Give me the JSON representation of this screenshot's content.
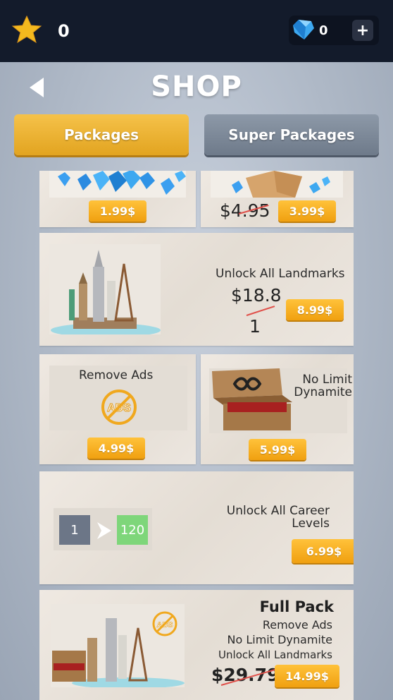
{
  "topbar": {
    "star_count": "0",
    "gem_count": "0",
    "plus_label": "+"
  },
  "header": {
    "title": "SHOP"
  },
  "tabs": [
    {
      "label": "Packages",
      "active": true
    },
    {
      "label": "Super Packages",
      "active": false
    }
  ],
  "packages": {
    "gems": {
      "price": "1.99$"
    },
    "crate": {
      "old_price": "$4.95",
      "price": "3.99$"
    },
    "landmarks": {
      "title": "Unlock All Landmarks",
      "old_price_line1": "$18.8",
      "old_price_line2": "1",
      "price": "8.99$"
    },
    "remove_ads": {
      "title": "Remove Ads",
      "badge": "ADS",
      "price": "4.99$"
    },
    "dynamite": {
      "title_line1": "No Limit",
      "title_line2": "Dynamite",
      "price": "5.99$"
    },
    "career": {
      "title_line1": "Unlock All Career",
      "title_line2": "Levels",
      "from_level": "1",
      "to_level": "120",
      "price": "6.99$"
    },
    "full_pack": {
      "title": "Full Pack",
      "line1": "Remove Ads",
      "line2": "No Limit Dynamite",
      "line3": "Unlock All Landmarks",
      "old_price": "$29.79",
      "price": "14.99$",
      "badge": "ADS"
    }
  },
  "colors": {
    "accent": "#f0a81e",
    "topbar": "#131b2b",
    "price_button": "#fbb42a"
  }
}
